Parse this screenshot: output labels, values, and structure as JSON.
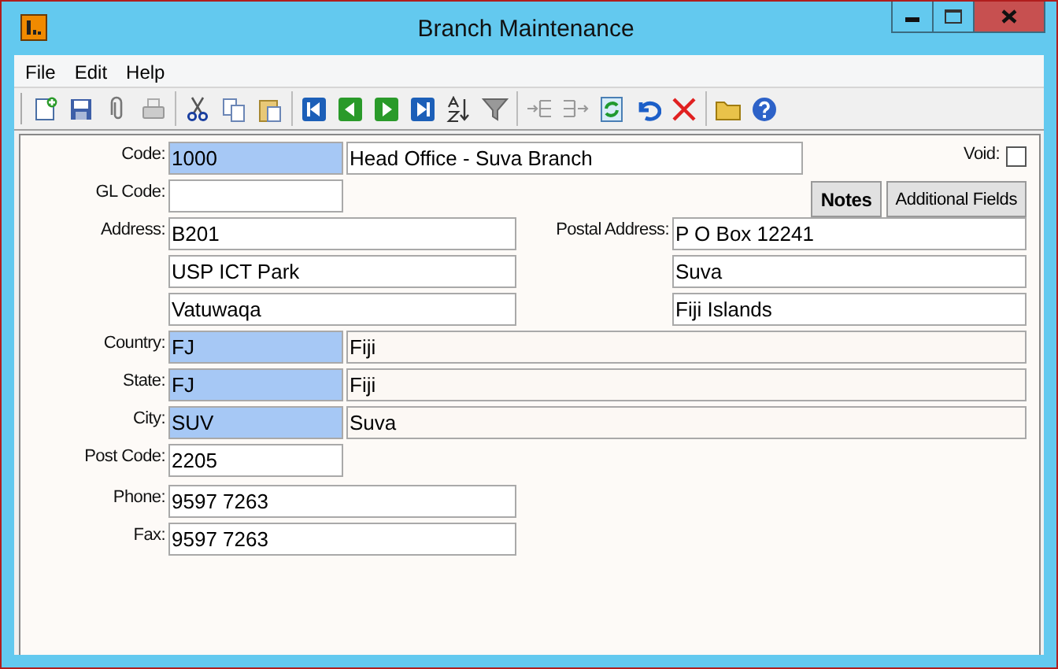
{
  "window": {
    "title": "Branch Maintenance"
  },
  "menu": [
    "File",
    "Edit",
    "Help"
  ],
  "form": {
    "code": {
      "label": "Code:",
      "value": "1000",
      "description": "Head Office - Suva Branch"
    },
    "void": {
      "label": "Void:",
      "checked": false
    },
    "gl_code": {
      "label": "GL Code:"
    },
    "buttons": [
      {
        "label": "Notes",
        "kind": "primary"
      },
      {
        "label": "Additional Fields",
        "kind": "normal"
      }
    ],
    "address": {
      "label": "Address:",
      "lines": [
        "B201",
        "USP ICT Park",
        "Vatuwaqa"
      ]
    },
    "postal_address": {
      "label": "Postal Address:",
      "lines": [
        "P O Box 12241",
        "Suva",
        "Fiji Islands"
      ]
    },
    "lookups": [
      {
        "label": "Country:",
        "code": "FJ",
        "name": "Fiji"
      },
      {
        "label": "State:",
        "code": "FJ",
        "name": "Fiji"
      },
      {
        "label": "City:",
        "code": "SUV",
        "name": "Suva"
      }
    ],
    "post_code": {
      "label": "Post Code:",
      "value": "2205"
    },
    "phone": {
      "label": "Phone:",
      "value": "9597 7263"
    },
    "fax": {
      "label": "Fax:",
      "value": "9597 7263"
    }
  }
}
